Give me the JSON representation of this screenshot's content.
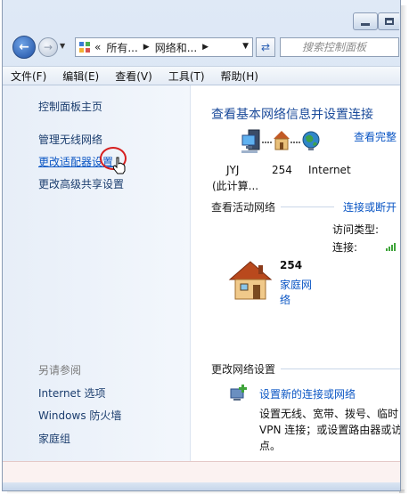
{
  "window": {
    "minimize_icon": "minimize-icon",
    "maximize_icon": "maximize-icon"
  },
  "nav": {
    "back_icon": "back-arrow-icon",
    "forward_icon": "forward-arrow-icon",
    "address_icon": "control-panel-icon",
    "address_prefix": "«",
    "address_segment_1": "所有...",
    "address_segment_2": "网络和...",
    "refresh_icon": "refresh-icon",
    "search_placeholder": "搜索控制面板"
  },
  "menu": {
    "file": "文件(F)",
    "edit": "编辑(E)",
    "view": "查看(V)",
    "tools": "工具(T)",
    "help": "帮助(H)"
  },
  "sidebar": {
    "home": "控制面板主页",
    "manage_wireless": "管理无线网络",
    "change_adapter": "更改适配器设置",
    "change_sharing": "更改高级共享设置",
    "see_also_heading": "另请参阅",
    "see_also": [
      "Internet 选项",
      "Windows 防火墙",
      "家庭组"
    ]
  },
  "main": {
    "title": "查看基本网络信息并设置连接",
    "view_full_map": "查看完整",
    "map": {
      "computer_name": "JYJ",
      "computer_sub": "(此计算...",
      "network_name": "254",
      "internet_label": "Internet"
    },
    "active_networks_heading": "查看活动网络",
    "connect_disconnect": "连接或断开",
    "access_type_label": "访问类型:",
    "connection_label": "连接:",
    "network": {
      "name": "254",
      "category_line1": "家庭网",
      "category_line2": "络"
    },
    "change_settings_heading": "更改网络设置",
    "setup_link": "设置新的连接或网络",
    "setup_desc": [
      "设置无线、宽带、拨号、临时",
      "VPN 连接；或设置路由器或访",
      "点。"
    ]
  },
  "colors": {
    "link": "#0b56c4",
    "title": "#1a4a9a",
    "sidebar_bg": "#e7eef8",
    "highlight_ring": "#d61f1f"
  }
}
